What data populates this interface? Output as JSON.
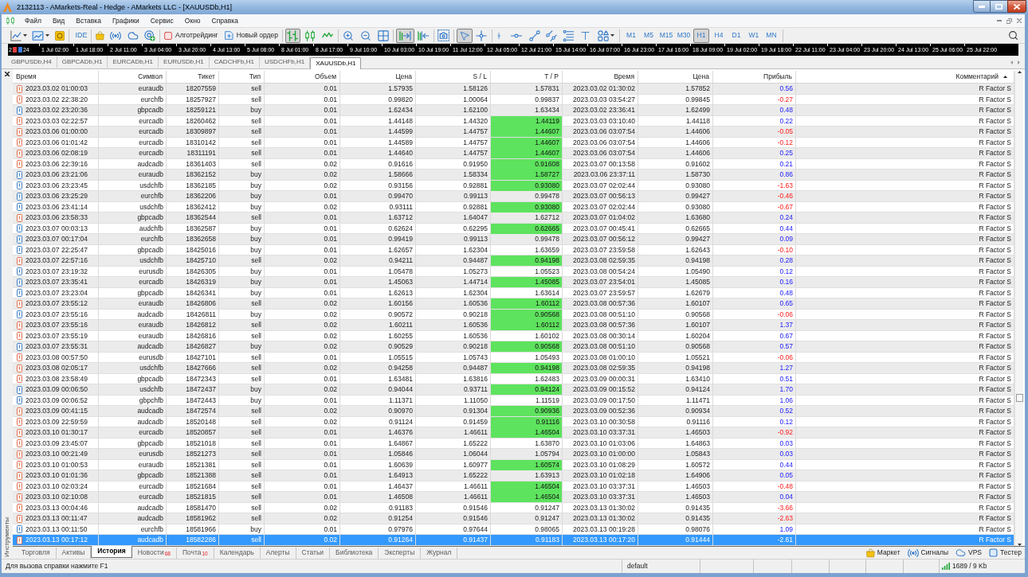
{
  "window": {
    "title": "2132113 - AMarkets-Real - Hedge - AMarkets LLC - [XAUUSDb,H1]"
  },
  "menu": [
    "Файл",
    "Вид",
    "Вставка",
    "Графики",
    "Сервис",
    "Окно",
    "Справка"
  ],
  "toolbar": {
    "ide": "IDE",
    "algo_trading": {
      "label": "Алготрейдинг",
      "on": false
    },
    "new_order": "Новый ордер",
    "chart_types": [
      {
        "kind": "bars",
        "selected": true
      },
      {
        "kind": "candles",
        "selected": false
      },
      {
        "kind": "line",
        "selected": false
      }
    ],
    "auto_scroll": {
      "on": true
    },
    "chart_shift": {
      "on": false
    },
    "pointer_tools": [
      {
        "kind": "cursor",
        "selected": true
      },
      {
        "kind": "crosshair",
        "selected": false
      }
    ],
    "timeframes": [
      {
        "label": "M1",
        "selected": false
      },
      {
        "label": "M5",
        "selected": false
      },
      {
        "label": "M15",
        "selected": false
      },
      {
        "label": "M30",
        "selected": false
      },
      {
        "label": "H1",
        "selected": true
      },
      {
        "label": "H4",
        "selected": false
      },
      {
        "label": "D1",
        "selected": false
      },
      {
        "label": "W1",
        "selected": false
      },
      {
        "label": "MN",
        "selected": false
      }
    ]
  },
  "chart": {
    "first_label_parts": [
      "2",
      "24"
    ],
    "time_labels": [
      "1 Jul 02:00",
      "1 Jul 18:00",
      "2 Jul 11:00",
      "3 Jul 04:00",
      "3 Jul 20:00",
      "4 Jul 13:00",
      "5 Jul 08:00",
      "8 Jul 01:00",
      "8 Jul 17:00",
      "9 Jul 10:00",
      "10 Jul 03:00",
      "10 Jul 19:00",
      "11 Jul 12:00",
      "12 Jul 05:00",
      "12 Jul 21:00",
      "15 Jul 14:00",
      "16 Jul 07:00",
      "16 Jul 23:00",
      "17 Jul 16:00",
      "18 Jul 09:00",
      "19 Jul 02:00",
      "19 Jul 18:00",
      "22 Jul 11:00",
      "23 Jul 04:00",
      "23 Jul 20:00",
      "24 Jul 13:00",
      "25 Jul 06:00",
      "25 Jul 22:00"
    ]
  },
  "chart_tabs": [
    {
      "label": "GBPUSDb,H4",
      "selected": false
    },
    {
      "label": "GBPCADb,H1",
      "selected": false
    },
    {
      "label": "EURCADb,H1",
      "selected": false
    },
    {
      "label": "EURUSDb,H1",
      "selected": false
    },
    {
      "label": "CADCHFb,H1",
      "selected": false
    },
    {
      "label": "USDCHFb,H1",
      "selected": false
    },
    {
      "label": "XAUUSDb,H1",
      "selected": true
    }
  ],
  "toolbox": {
    "title": "Инструменты",
    "columns": [
      {
        "label": "Время",
        "sorted": false
      },
      {
        "label": "Символ",
        "sorted": false
      },
      {
        "label": "Тикет",
        "sorted": false
      },
      {
        "label": "Тип",
        "sorted": false
      },
      {
        "label": "Объем",
        "sorted": false
      },
      {
        "label": "Цена",
        "sorted": false
      },
      {
        "label": "S / L",
        "sorted": false
      },
      {
        "label": "T / P",
        "sorted": false
      },
      {
        "label": "Время",
        "sorted": false
      },
      {
        "label": "Цена",
        "sorted": false
      },
      {
        "label": "Прибыль",
        "sorted": false
      },
      {
        "label": "Комментарий",
        "sorted": true
      }
    ],
    "rows": [
      {
        "kind": "sell",
        "cells": [
          "2023.03.02 01:00:03",
          "euraudb",
          "18207559",
          "sell",
          "0.01",
          "1.57935",
          "1.58126",
          "1.57831",
          "2023.03.02 01:30:02",
          "1.57852",
          "0.56",
          "R Factor S"
        ],
        "tp_hit": false,
        "loss": false,
        "selected": false
      },
      {
        "kind": "sell",
        "cells": [
          "2023.03.02 22:38:20",
          "eurchfb",
          "18257927",
          "sell",
          "0.01",
          "0.99820",
          "1.00064",
          "0.99837",
          "2023.03.03 03:54:27",
          "0.99845",
          "-0.27",
          "R Factor S"
        ],
        "tp_hit": false,
        "loss": true,
        "selected": false
      },
      {
        "kind": "buy",
        "cells": [
          "2023.03.02 23:20:36",
          "gbpcadb",
          "18259121",
          "buy",
          "0.01",
          "1.62434",
          "1.62100",
          "1.63434",
          "2023.03.02 23:36:41",
          "1.62499",
          "0.48",
          "R Factor S"
        ],
        "tp_hit": false,
        "loss": false,
        "selected": false
      },
      {
        "kind": "sell",
        "cells": [
          "2023.03.03 02:22:57",
          "eurcadb",
          "18260462",
          "sell",
          "0.01",
          "1.44148",
          "1.44320",
          "1.44119",
          "2023.03.03 03:10:40",
          "1.44118",
          "0.22",
          "R Factor S"
        ],
        "tp_hit": true,
        "loss": false,
        "selected": false
      },
      {
        "kind": "sell",
        "cells": [
          "2023.03.06 01:00:00",
          "eurcadb",
          "18309897",
          "sell",
          "0.01",
          "1.44599",
          "1.44757",
          "1.44607",
          "2023.03.06 03:07:54",
          "1.44606",
          "-0.05",
          "R Factor S"
        ],
        "tp_hit": true,
        "loss": true,
        "selected": false
      },
      {
        "kind": "sell",
        "cells": [
          "2023.03.06 01:01:42",
          "eurcadb",
          "18310142",
          "sell",
          "0.01",
          "1.44589",
          "1.44757",
          "1.44607",
          "2023.03.06 03:07:54",
          "1.44606",
          "-0.12",
          "R Factor S"
        ],
        "tp_hit": true,
        "loss": true,
        "selected": false
      },
      {
        "kind": "sell",
        "cells": [
          "2023.03.06 02:08:19",
          "eurcadb",
          "18311191",
          "sell",
          "0.01",
          "1.44640",
          "1.44757",
          "1.44607",
          "2023.03.06 03:07:54",
          "1.44606",
          "0.25",
          "R Factor S"
        ],
        "tp_hit": true,
        "loss": false,
        "selected": false
      },
      {
        "kind": "sell",
        "cells": [
          "2023.03.06 22:39:16",
          "audcadb",
          "18361403",
          "sell",
          "0.02",
          "0.91616",
          "0.91950",
          "0.91608",
          "2023.03.07 00:13:58",
          "0.91602",
          "0.21",
          "R Factor S"
        ],
        "tp_hit": true,
        "loss": false,
        "selected": false
      },
      {
        "kind": "buy",
        "cells": [
          "2023.03.06 23:21:06",
          "euraudb",
          "18362152",
          "buy",
          "0.02",
          "1.58666",
          "1.58334",
          "1.58727",
          "2023.03.06 23:37:11",
          "1.58730",
          "0.86",
          "R Factor S"
        ],
        "tp_hit": true,
        "loss": false,
        "selected": false
      },
      {
        "kind": "buy",
        "cells": [
          "2023.03.06 23:23:45",
          "usdchfb",
          "18362185",
          "buy",
          "0.02",
          "0.93156",
          "0.92881",
          "0.93080",
          "2023.03.07 02:02:44",
          "0.93080",
          "-1.63",
          "R Factor S"
        ],
        "tp_hit": true,
        "loss": true,
        "selected": false
      },
      {
        "kind": "buy",
        "cells": [
          "2023.03.06 23:25:29",
          "eurchfb",
          "18362206",
          "buy",
          "0.01",
          "0.99470",
          "0.99113",
          "0.99478",
          "2023.03.07 00:56:13",
          "0.99427",
          "-0.46",
          "R Factor S"
        ],
        "tp_hit": false,
        "loss": true,
        "selected": false
      },
      {
        "kind": "buy",
        "cells": [
          "2023.03.06 23:41:14",
          "usdchfb",
          "18362412",
          "buy",
          "0.02",
          "0.93111",
          "0.92881",
          "0.93080",
          "2023.03.07 02:02:44",
          "0.93080",
          "-0.67",
          "R Factor S"
        ],
        "tp_hit": true,
        "loss": true,
        "selected": false
      },
      {
        "kind": "sell",
        "cells": [
          "2023.03.06 23:58:33",
          "gbpcadb",
          "18362544",
          "sell",
          "0.01",
          "1.63712",
          "1.64047",
          "1.62712",
          "2023.03.07 01:04:02",
          "1.63680",
          "0.24",
          "R Factor S"
        ],
        "tp_hit": false,
        "loss": false,
        "selected": false
      },
      {
        "kind": "buy",
        "cells": [
          "2023.03.07 00:03:13",
          "audchfb",
          "18362587",
          "buy",
          "0.01",
          "0.62624",
          "0.62295",
          "0.62665",
          "2023.03.07 00:45:41",
          "0.62665",
          "0.44",
          "R Factor S"
        ],
        "tp_hit": true,
        "loss": false,
        "selected": false
      },
      {
        "kind": "buy",
        "cells": [
          "2023.03.07 00:17:04",
          "eurchfb",
          "18362658",
          "buy",
          "0.01",
          "0.99419",
          "0.99113",
          "0.99478",
          "2023.03.07 00:56:12",
          "0.99427",
          "0.09",
          "R Factor S"
        ],
        "tp_hit": false,
        "loss": false,
        "selected": false
      },
      {
        "kind": "buy",
        "cells": [
          "2023.03.07 22:25:47",
          "gbpcadb",
          "18425016",
          "buy",
          "0.01",
          "1.62657",
          "1.62304",
          "1.63659",
          "2023.03.07 23:59:58",
          "1.62643",
          "-0.10",
          "R Factor S"
        ],
        "tp_hit": false,
        "loss": true,
        "selected": false
      },
      {
        "kind": "sell",
        "cells": [
          "2023.03.07 22:57:16",
          "usdchfb",
          "18425710",
          "sell",
          "0.02",
          "0.94211",
          "0.94487",
          "0.94198",
          "2023.03.08 02:59:35",
          "0.94198",
          "0.28",
          "R Factor S"
        ],
        "tp_hit": true,
        "loss": false,
        "selected": false
      },
      {
        "kind": "buy",
        "cells": [
          "2023.03.07 23:19:32",
          "eurusdb",
          "18426305",
          "buy",
          "0.01",
          "1.05478",
          "1.05273",
          "1.05523",
          "2023.03.08 00:54:24",
          "1.05490",
          "0.12",
          "R Factor S"
        ],
        "tp_hit": false,
        "loss": false,
        "selected": false
      },
      {
        "kind": "buy",
        "cells": [
          "2023.03.07 23:35:41",
          "eurcadb",
          "18426319",
          "buy",
          "0.01",
          "1.45063",
          "1.44714",
          "1.45085",
          "2023.03.07 23:54:01",
          "1.45085",
          "0.16",
          "R Factor S"
        ],
        "tp_hit": true,
        "loss": false,
        "selected": false
      },
      {
        "kind": "buy",
        "cells": [
          "2023.03.07 23:23:04",
          "gbpcadb",
          "18426341",
          "buy",
          "0.01",
          "1.62613",
          "1.62304",
          "1.63614",
          "2023.03.07 23:59:57",
          "1.62679",
          "0.48",
          "R Factor S"
        ],
        "tp_hit": false,
        "loss": false,
        "selected": false
      },
      {
        "kind": "sell",
        "cells": [
          "2023.03.07 23:55:12",
          "euraudb",
          "18426806",
          "sell",
          "0.02",
          "1.60156",
          "1.60536",
          "1.60112",
          "2023.03.08 00:57:36",
          "1.60107",
          "0.65",
          "R Factor S"
        ],
        "tp_hit": true,
        "loss": false,
        "selected": false
      },
      {
        "kind": "buy",
        "cells": [
          "2023.03.07 23:55:16",
          "audcadb",
          "18426811",
          "buy",
          "0.02",
          "0.90572",
          "0.90218",
          "0.90568",
          "2023.03.08 00:51:10",
          "0.90568",
          "-0.06",
          "R Factor S"
        ],
        "tp_hit": true,
        "loss": true,
        "selected": false
      },
      {
        "kind": "sell",
        "cells": [
          "2023.03.07 23:55:16",
          "euraudb",
          "18426812",
          "sell",
          "0.02",
          "1.60211",
          "1.60536",
          "1.60112",
          "2023.03.08 00:57:36",
          "1.60107",
          "1.37",
          "R Factor S"
        ],
        "tp_hit": true,
        "loss": false,
        "selected": false
      },
      {
        "kind": "sell",
        "cells": [
          "2023.03.07 23:55:19",
          "euraudb",
          "18426816",
          "sell",
          "0.02",
          "1.60255",
          "1.60536",
          "1.60102",
          "2023.03.08 00:30:14",
          "1.60204",
          "0.67",
          "R Factor S"
        ],
        "tp_hit": false,
        "loss": false,
        "selected": false
      },
      {
        "kind": "buy",
        "cells": [
          "2023.03.07 23:55:31",
          "audcadb",
          "18426827",
          "buy",
          "0.02",
          "0.90529",
          "0.90218",
          "0.90568",
          "2023.03.08 00:51:10",
          "0.90568",
          "0.57",
          "R Factor S"
        ],
        "tp_hit": true,
        "loss": false,
        "selected": false
      },
      {
        "kind": "sell",
        "cells": [
          "2023.03.08 00:57:50",
          "eurusdb",
          "18427101",
          "sell",
          "0.01",
          "1.05515",
          "1.05743",
          "1.05493",
          "2023.03.08 01:00:10",
          "1.05521",
          "-0.06",
          "R Factor S"
        ],
        "tp_hit": false,
        "loss": true,
        "selected": false
      },
      {
        "kind": "sell",
        "cells": [
          "2023.03.08 02:05:17",
          "usdchfb",
          "18427666",
          "sell",
          "0.02",
          "0.94258",
          "0.94487",
          "0.94198",
          "2023.03.08 02:59:35",
          "0.94198",
          "1.27",
          "R Factor S"
        ],
        "tp_hit": true,
        "loss": false,
        "selected": false
      },
      {
        "kind": "sell",
        "cells": [
          "2023.03.08 23:58:49",
          "gbpcadb",
          "18472343",
          "sell",
          "0.01",
          "1.63481",
          "1.63816",
          "1.62483",
          "2023.03.09 00:00:31",
          "1.63410",
          "0.51",
          "R Factor S"
        ],
        "tp_hit": false,
        "loss": false,
        "selected": false
      },
      {
        "kind": "buy",
        "cells": [
          "2023.03.09 00:06:50",
          "usdchfb",
          "18472437",
          "buy",
          "0.02",
          "0.94044",
          "0.93711",
          "0.94124",
          "2023.03.09 00:15:52",
          "0.94124",
          "1.70",
          "R Factor S"
        ],
        "tp_hit": true,
        "loss": false,
        "selected": false
      },
      {
        "kind": "buy",
        "cells": [
          "2023.03.09 00:06:52",
          "gbpchfb",
          "18472443",
          "buy",
          "0.01",
          "1.11371",
          "1.11050",
          "1.11519",
          "2023.03.09 00:17:50",
          "1.11471",
          "1.06",
          "R Factor S"
        ],
        "tp_hit": false,
        "loss": false,
        "selected": false
      },
      {
        "kind": "sell",
        "cells": [
          "2023.03.09 00:41:15",
          "audcadb",
          "18472574",
          "sell",
          "0.02",
          "0.90970",
          "0.91304",
          "0.90936",
          "2023.03.09 00:52:36",
          "0.90934",
          "0.52",
          "R Factor S"
        ],
        "tp_hit": true,
        "loss": false,
        "selected": false
      },
      {
        "kind": "sell",
        "cells": [
          "2023.03.09 22:59:59",
          "audcadb",
          "18520148",
          "sell",
          "0.02",
          "0.91124",
          "0.91459",
          "0.91116",
          "2023.03.10 00:30:58",
          "0.91116",
          "0.12",
          "R Factor S"
        ],
        "tp_hit": true,
        "loss": false,
        "selected": false
      },
      {
        "kind": "sell",
        "cells": [
          "2023.03.10 01:30:17",
          "eurcadb",
          "18520857",
          "sell",
          "0.01",
          "1.46376",
          "1.46611",
          "1.46504",
          "2023.03.10 03:37:31",
          "1.46503",
          "-0.92",
          "R Factor S"
        ],
        "tp_hit": true,
        "loss": true,
        "selected": false
      },
      {
        "kind": "sell",
        "cells": [
          "2023.03.09 23:45:07",
          "gbpcadb",
          "18521018",
          "sell",
          "0.01",
          "1.64867",
          "1.65222",
          "1.63870",
          "2023.03.10 01:03:06",
          "1.64863",
          "0.03",
          "R Factor S"
        ],
        "tp_hit": false,
        "loss": false,
        "selected": false
      },
      {
        "kind": "sell",
        "cells": [
          "2023.03.10 00:21:49",
          "eurusdb",
          "18521273",
          "sell",
          "0.01",
          "1.05846",
          "1.06044",
          "1.05794",
          "2023.03.10 01:00:00",
          "1.05843",
          "0.03",
          "R Factor S"
        ],
        "tp_hit": false,
        "loss": false,
        "selected": false
      },
      {
        "kind": "sell",
        "cells": [
          "2023.03.10 01:00:53",
          "euraudb",
          "18521381",
          "sell",
          "0.01",
          "1.60639",
          "1.60977",
          "1.60574",
          "2023.03.10 01:08:29",
          "1.60572",
          "0.44",
          "R Factor S"
        ],
        "tp_hit": true,
        "loss": false,
        "selected": false
      },
      {
        "kind": "sell",
        "cells": [
          "2023.03.10 01:01:36",
          "gbpcadb",
          "18521388",
          "sell",
          "0.01",
          "1.64913",
          "1.65222",
          "1.63913",
          "2023.03.10 01:02:18",
          "1.64906",
          "0.05",
          "R Factor S"
        ],
        "tp_hit": false,
        "loss": false,
        "selected": false
      },
      {
        "kind": "sell",
        "cells": [
          "2023.03.10 02:03:24",
          "eurcadb",
          "18521684",
          "sell",
          "0.01",
          "1.46437",
          "1.46611",
          "1.46504",
          "2023.03.10 03:37:31",
          "1.46503",
          "-0.48",
          "R Factor S"
        ],
        "tp_hit": true,
        "loss": true,
        "selected": false
      },
      {
        "kind": "sell",
        "cells": [
          "2023.03.10 02:10:08",
          "eurcadb",
          "18521815",
          "sell",
          "0.01",
          "1.46508",
          "1.46611",
          "1.46504",
          "2023.03.10 03:37:31",
          "1.46503",
          "0.04",
          "R Factor S"
        ],
        "tp_hit": true,
        "loss": false,
        "selected": false
      },
      {
        "kind": "sell",
        "cells": [
          "2023.03.13 00:04:46",
          "audcadb",
          "18581470",
          "sell",
          "0.02",
          "0.91183",
          "0.91546",
          "0.91247",
          "2023.03.13 01:30:02",
          "0.91435",
          "-3.66",
          "R Factor S"
        ],
        "tp_hit": false,
        "loss": true,
        "selected": false
      },
      {
        "kind": "sell",
        "cells": [
          "2023.03.13 00:11:47",
          "audcadb",
          "18581962",
          "sell",
          "0.02",
          "0.91254",
          "0.91546",
          "0.91247",
          "2023.03.13 01:30:02",
          "0.91435",
          "-2.63",
          "R Factor S"
        ],
        "tp_hit": false,
        "loss": true,
        "selected": false
      },
      {
        "kind": "buy",
        "cells": [
          "2023.03.13 00:11:50",
          "eurchfb",
          "18581966",
          "buy",
          "0.01",
          "0.97976",
          "0.97644",
          "0.98065",
          "2023.03.13 00:19:28",
          "0.98076",
          "1.09",
          "R Factor S"
        ],
        "tp_hit": false,
        "loss": false,
        "selected": false
      },
      {
        "kind": "sell",
        "cells": [
          "2023.03.13 00:17:12",
          "audcadb",
          "18582286",
          "sell",
          "0.02",
          "0.91264",
          "0.91437",
          "0.91183",
          "2023.03.13 00:17:20",
          "0.91444",
          "-2.61",
          "R Factor S"
        ],
        "tp_hit": false,
        "selected": true
      }
    ],
    "tabs": [
      {
        "label": "Торговля",
        "selected": false
      },
      {
        "label": "Активы",
        "selected": false
      },
      {
        "label": "История",
        "selected": true
      },
      {
        "label": "Новости",
        "count": "68",
        "selected": false
      },
      {
        "label": "Почта",
        "count": "10",
        "selected": false
      },
      {
        "label": "Календарь",
        "selected": false
      },
      {
        "label": "Алерты",
        "selected": false
      },
      {
        "label": "Статьи",
        "selected": false
      },
      {
        "label": "Библиотека",
        "selected": false
      },
      {
        "label": "Эксперты",
        "selected": false
      },
      {
        "label": "Журнал",
        "selected": false
      }
    ],
    "services": [
      {
        "kind": "market",
        "label": "Маркет"
      },
      {
        "kind": "signals",
        "label": "Сигналы"
      },
      {
        "kind": "vps",
        "label": "VPS"
      },
      {
        "kind": "tester",
        "label": "Тестер"
      }
    ]
  },
  "status_bar": {
    "help": "Для вызова справки нажмите F1",
    "profile": "default",
    "traffic": "1689 / 9 Kb"
  }
}
